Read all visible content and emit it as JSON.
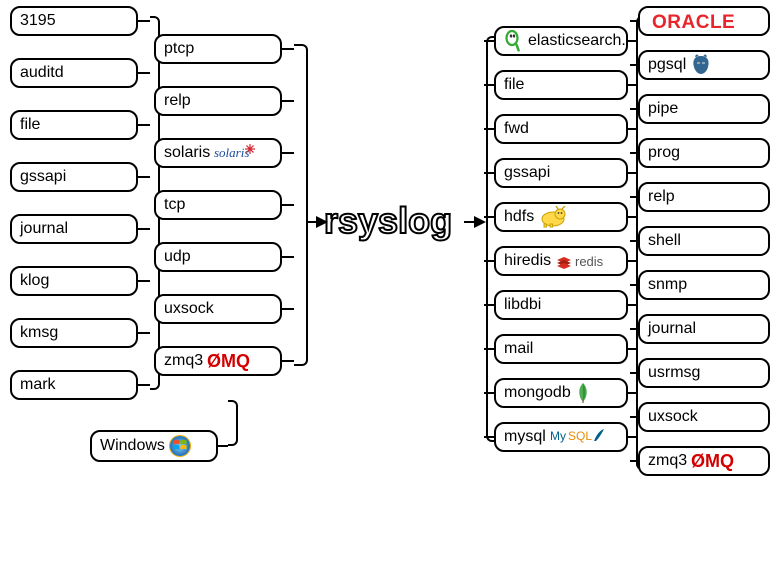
{
  "center": {
    "label": "rsyslog"
  },
  "inputs_left": [
    {
      "label": "3195"
    },
    {
      "label": "auditd"
    },
    {
      "label": "file"
    },
    {
      "label": "gssapi"
    },
    {
      "label": "journal"
    },
    {
      "label": "klog"
    },
    {
      "label": "kmsg"
    },
    {
      "label": "mark"
    }
  ],
  "inputs_right": [
    {
      "label": "ptcp"
    },
    {
      "label": "relp"
    },
    {
      "label": "solaris",
      "icon": "solaris"
    },
    {
      "label": "tcp"
    },
    {
      "label": "udp"
    },
    {
      "label": "uxsock"
    },
    {
      "label": "zmq3",
      "icon": "zeromq"
    }
  ],
  "input_bottom": {
    "label": "Windows",
    "icon": "windows"
  },
  "outputs_left": [
    {
      "label": "elasticsearch.",
      "icon": "elasticsearch",
      "icon_pos": "before"
    },
    {
      "label": "file"
    },
    {
      "label": "fwd"
    },
    {
      "label": "gssapi"
    },
    {
      "label": "hdfs",
      "icon": "hadoop"
    },
    {
      "label": "hiredis",
      "icon": "redis"
    },
    {
      "label": "libdbi"
    },
    {
      "label": "mail"
    },
    {
      "label": "mongodb",
      "icon": "mongodb"
    },
    {
      "label": "mysql",
      "icon": "mysql"
    }
  ],
  "outputs_right": [
    {
      "label": "",
      "icon": "oracle"
    },
    {
      "label": "pgsql",
      "icon": "postgresql"
    },
    {
      "label": "pipe"
    },
    {
      "label": "prog"
    },
    {
      "label": "relp"
    },
    {
      "label": "shell"
    },
    {
      "label": "snmp"
    },
    {
      "label": "journal"
    },
    {
      "label": "usrmsg"
    },
    {
      "label": "uxsock"
    },
    {
      "label": "zmq3",
      "icon": "zeromq"
    }
  ]
}
